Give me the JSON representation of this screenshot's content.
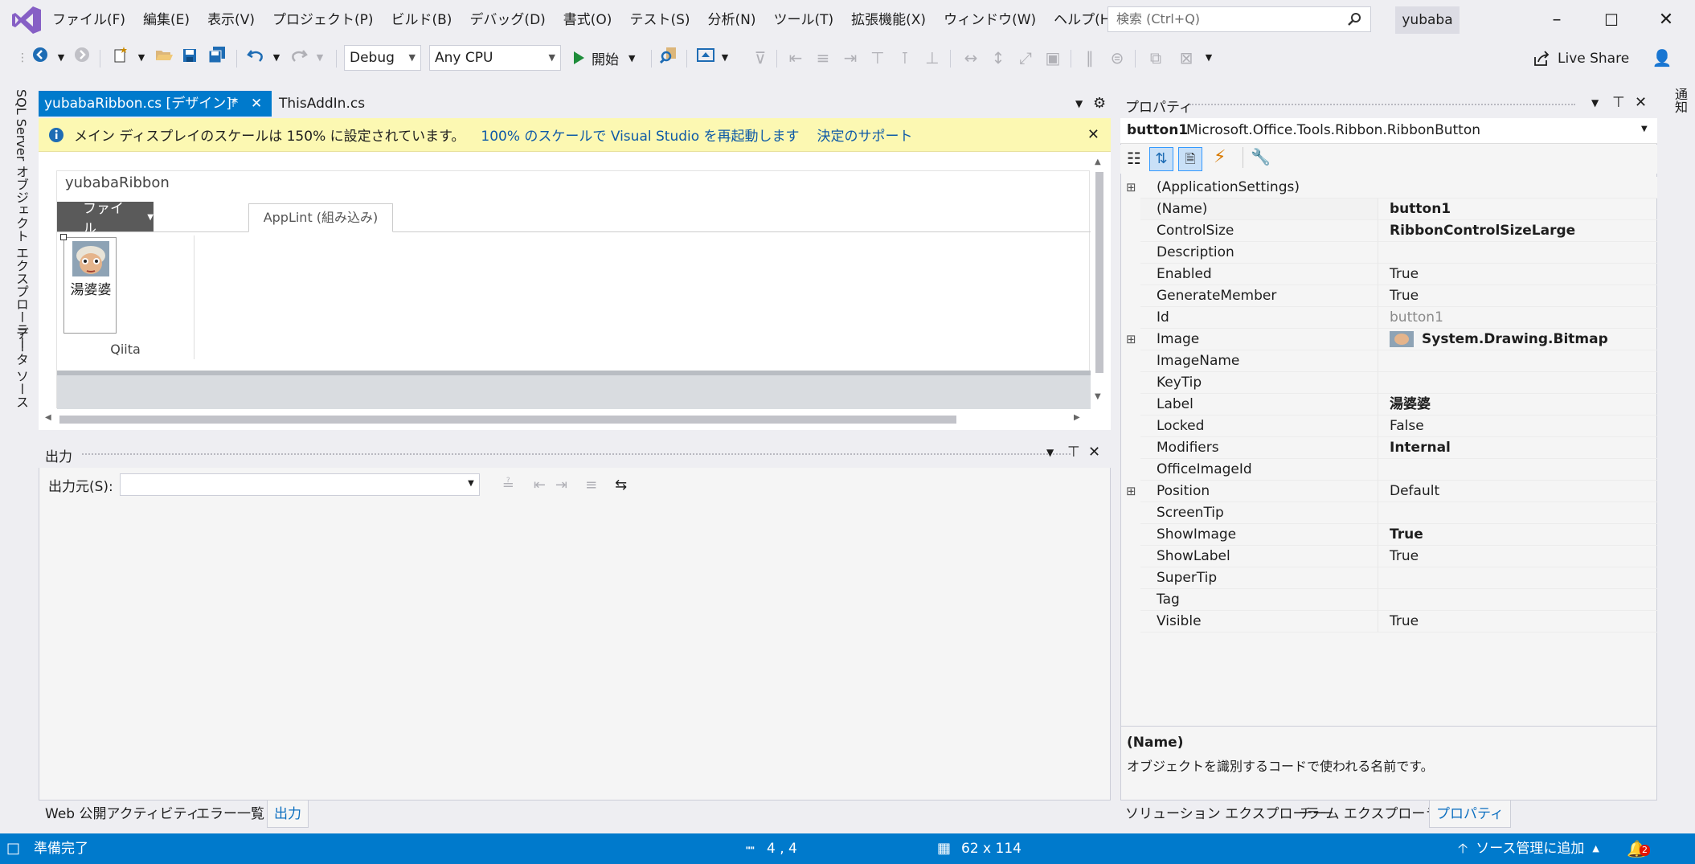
{
  "menubar": {
    "items": [
      "ファイル(F)",
      "編集(E)",
      "表示(V)",
      "プロジェクト(P)",
      "ビルド(B)",
      "デバッグ(D)",
      "書式(O)",
      "テスト(S)",
      "分析(N)",
      "ツール(T)",
      "拡張機能(X)",
      "ウィンドウ(W)",
      "ヘルプ(H)"
    ],
    "search_placeholder": "検索 (Ctrl+Q)",
    "user": "yubaba"
  },
  "toolbar": {
    "config": "Debug",
    "platform": "Any CPU",
    "start_label": "開始",
    "live_share": "Live Share"
  },
  "left_strip": {
    "sql": "SQL Server オブジェクト エクスプローラー",
    "datasource": "データ ソース"
  },
  "right_strip": {
    "notify": "通知"
  },
  "doc_tabs": {
    "active": "yubabaRibbon.cs [デザイン]*",
    "second": "ThisAddIn.cs"
  },
  "infobar": {
    "message": "メイン ディスプレイのスケールは 150% に設定されています。",
    "link1": "100% のスケールで Visual Studio を再起動します",
    "link2": "決定のサポート"
  },
  "ribbon": {
    "name": "yubabaRibbon",
    "file_tab": "ファイル",
    "tab": "AppLint (組み込み)",
    "button_label": "湯婆婆",
    "group_label": "Qiita"
  },
  "output": {
    "title": "出力",
    "source_label": "出力元(S):",
    "source_value": ""
  },
  "bottom_tabs": [
    "Web 公開アクティビティ",
    "エラー一覧",
    "出力"
  ],
  "properties": {
    "title": "プロパティ",
    "object_name": "button1",
    "object_type": "Microsoft.Office.Tools.Ribbon.RibbonButton",
    "rows": [
      {
        "name": "(ApplicationSettings)",
        "value": "",
        "expand": true,
        "full": true
      },
      {
        "name": "(Name)",
        "value": "button1",
        "bold": true,
        "sel": true
      },
      {
        "name": "ControlSize",
        "value": "RibbonControlSizeLarge",
        "bold": true
      },
      {
        "name": "Description",
        "value": ""
      },
      {
        "name": "Enabled",
        "value": "True"
      },
      {
        "name": "GenerateMember",
        "value": "True"
      },
      {
        "name": "Id",
        "value": "button1",
        "grey": true
      },
      {
        "name": "Image",
        "value": "System.Drawing.Bitmap",
        "bold": true,
        "expand": true,
        "image": true
      },
      {
        "name": "ImageName",
        "value": ""
      },
      {
        "name": "KeyTip",
        "value": ""
      },
      {
        "name": "Label",
        "value": "湯婆婆",
        "bold": true
      },
      {
        "name": "Locked",
        "value": "False"
      },
      {
        "name": "Modifiers",
        "value": "Internal",
        "bold": true
      },
      {
        "name": "OfficeImageId",
        "value": ""
      },
      {
        "name": "Position",
        "value": "Default",
        "expand": true
      },
      {
        "name": "ScreenTip",
        "value": ""
      },
      {
        "name": "ShowImage",
        "value": "True",
        "bold": true
      },
      {
        "name": "ShowLabel",
        "value": "True"
      },
      {
        "name": "SuperTip",
        "value": ""
      },
      {
        "name": "Tag",
        "value": ""
      },
      {
        "name": "Visible",
        "value": "True"
      }
    ],
    "desc_title": "(Name)",
    "desc_text": "オブジェクトを識別するコードで使われる名前です。"
  },
  "prop_tabs": [
    "ソリューション エクスプローラー",
    "チーム エクスプローラー",
    "プロパティ"
  ],
  "statusbar": {
    "ready": "準備完了",
    "position": "4 , 4",
    "size": "62 x 114",
    "source_control": "ソース管理に追加",
    "notif_count": "2"
  },
  "colors": {
    "accent": "#007acc",
    "info": "#fcf8b2",
    "vs_purple": "#865fc5"
  }
}
